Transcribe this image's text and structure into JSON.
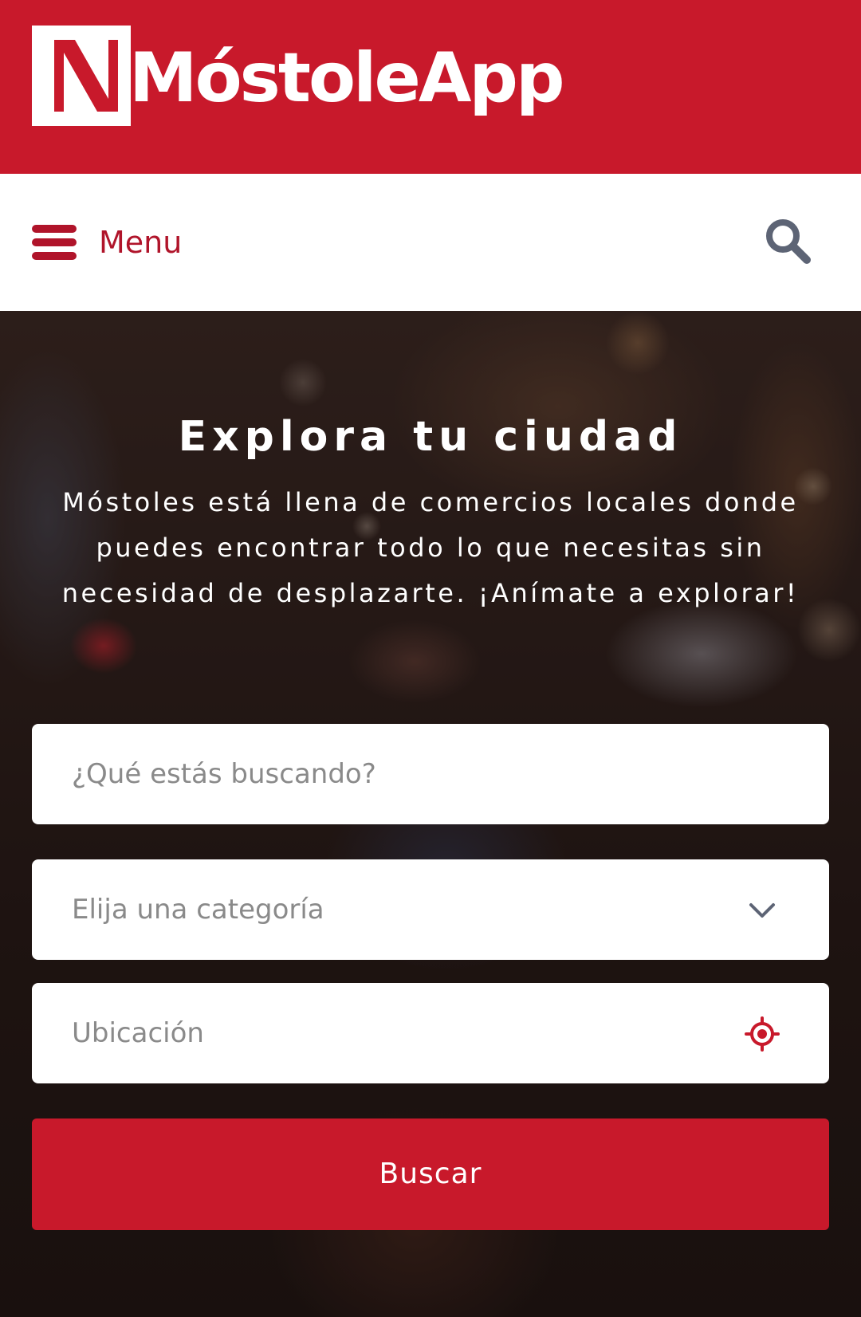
{
  "app": {
    "name": "MóstoleApp",
    "brand_color": "#c8192b",
    "accent_color": "#b0142a"
  },
  "nav": {
    "menu_label": "Menu",
    "menu_icon": "hamburger-icon",
    "search_icon": "search-icon"
  },
  "hero": {
    "title": "Explora tu ciudad",
    "description": "Móstoles está llena de comercios locales donde puedes encontrar todo lo que necesitas sin necesidad de desplazarte. ¡Anímate a explorar!"
  },
  "form": {
    "search_placeholder": "¿Qué estás buscando?",
    "category_placeholder": "Elija una categoría",
    "category_icon": "chevron-down-icon",
    "location_placeholder": "Ubicación",
    "location_icon": "location-target-icon",
    "submit_label": "Buscar"
  }
}
